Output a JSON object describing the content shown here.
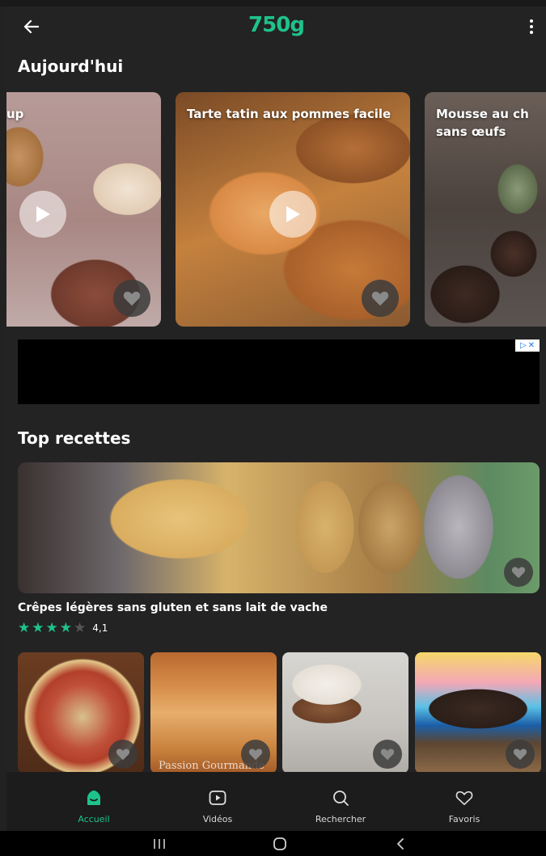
{
  "app": {
    "logo": "750g",
    "accent_color": "#1ec28b"
  },
  "topbar": {
    "back_icon": "arrow-left-icon",
    "menu_icon": "more-vertical-icon"
  },
  "today": {
    "title": "Aujourd'hui",
    "cards": [
      {
        "title": "up",
        "video": true
      },
      {
        "title": "Tarte tatin aux pommes facile",
        "video": true
      },
      {
        "title": "Mousse au chocolat sans œufs",
        "title_visible": "Mousse au ch\nsans œufs",
        "video": false
      }
    ]
  },
  "ad": {
    "badge_icons": [
      "adchoices-icon",
      "close-icon"
    ]
  },
  "top_recipes": {
    "title": "Top recettes",
    "featured": {
      "name": "Crêpes légères sans gluten et sans lait de vache",
      "rating": 4.1,
      "rating_text": "4,1",
      "stars_filled": 4,
      "stars_total": 5
    },
    "thumbnails": [
      {
        "name": "pizza"
      },
      {
        "name": "galette",
        "watermark": "Passion Gourmande"
      },
      {
        "name": "cake"
      },
      {
        "name": "smarties-cake"
      }
    ]
  },
  "bottom_nav": {
    "items": [
      {
        "label": "Accueil",
        "icon": "home-icon",
        "active": true
      },
      {
        "label": "Vidéos",
        "icon": "video-icon",
        "active": false
      },
      {
        "label": "Rechercher",
        "icon": "search-icon",
        "active": false
      },
      {
        "label": "Favoris",
        "icon": "heart-icon",
        "active": false
      }
    ]
  },
  "system_nav": {
    "items": [
      "recent-apps-icon",
      "home-button-icon",
      "back-button-icon"
    ]
  }
}
